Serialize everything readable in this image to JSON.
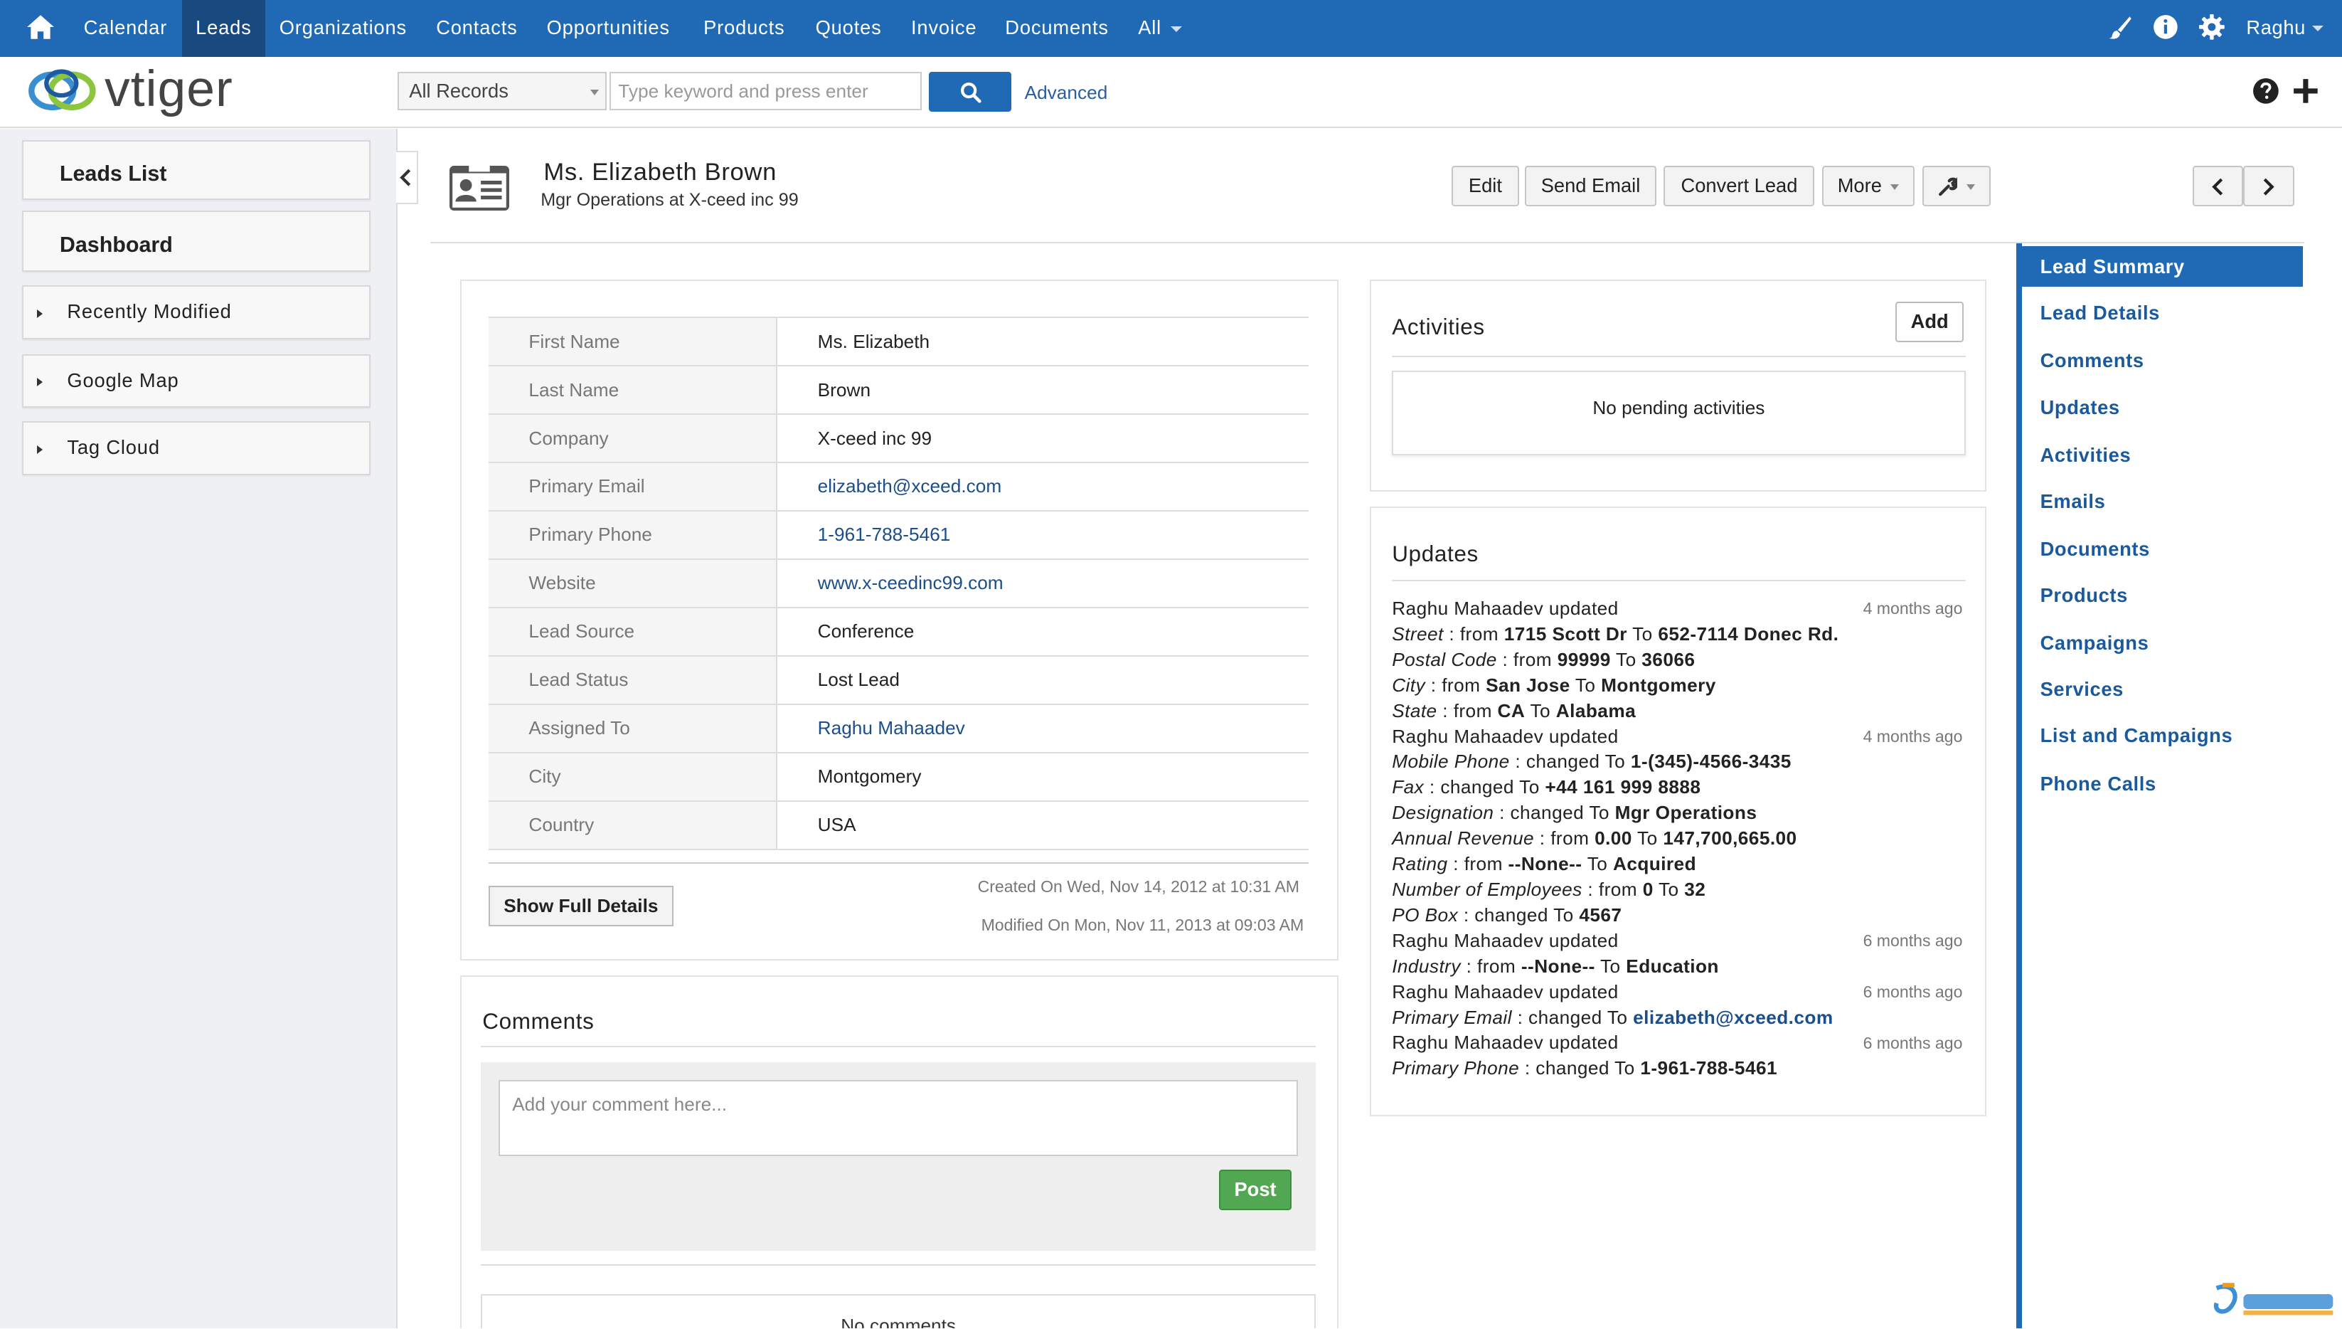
{
  "nav": {
    "menu": [
      "Calendar",
      "Leads",
      "Organizations",
      "Contacts",
      "Opportunities",
      "Products",
      "Quotes",
      "Invoice",
      "Documents",
      "All"
    ],
    "active": "Leads",
    "user": "Raghu"
  },
  "header": {
    "logo_text": "vtiger",
    "records_select": "All Records",
    "search_placeholder": "Type keyword and press enter",
    "advanced": "Advanced"
  },
  "sidebar": {
    "leads_list": "Leads List",
    "dashboard": "Dashboard",
    "widgets": [
      "Recently Modified",
      "Google Map",
      "Tag Cloud"
    ]
  },
  "record": {
    "title": "Ms. Elizabeth Brown",
    "subtitle": "Mgr Operations at X-ceed inc 99",
    "actions": [
      "Edit",
      "Send Email",
      "Convert Lead",
      "More"
    ]
  },
  "details": [
    {
      "label": "First Name",
      "value": "Ms. Elizabeth"
    },
    {
      "label": "Last Name",
      "value": "Brown"
    },
    {
      "label": "Company",
      "value": "X-ceed inc 99"
    },
    {
      "label": "Primary Email",
      "value": "elizabeth@xceed.com"
    },
    {
      "label": "Primary Phone",
      "value": "1-961-788-5461"
    },
    {
      "label": "Website",
      "value": "www.x-ceedinc99.com"
    },
    {
      "label": "Lead Source",
      "value": "Conference"
    },
    {
      "label": "Lead Status",
      "value": "Lost Lead"
    },
    {
      "label": "Assigned To",
      "value": "Raghu Mahaadev"
    },
    {
      "label": "City",
      "value": "Montgomery"
    },
    {
      "label": "Country",
      "value": "USA"
    }
  ],
  "summary": {
    "show_full": "Show Full Details",
    "created": "Created On Wed, Nov 14, 2012 at 10:31 AM",
    "modified": "Modified On Mon, Nov 11, 2013 at 09:03 AM"
  },
  "comments": {
    "title": "Comments",
    "placeholder": "Add your comment here...",
    "post": "Post",
    "empty": "No comments"
  },
  "activities": {
    "title": "Activities",
    "add": "Add",
    "empty": "No pending activities"
  },
  "updates": {
    "title": "Updates",
    "who": "Raghu Mahaadev",
    "verb": "updated",
    "groups": [
      {
        "time": "4 months ago",
        "changes": [
          {
            "field": "Street",
            "kind": "from",
            "from": "1715 Scott Dr",
            "to": "652-7114 Donec Rd."
          },
          {
            "field": "Postal Code",
            "kind": "from",
            "from": "99999",
            "to": "36066"
          },
          {
            "field": "City",
            "kind": "from",
            "from": "San Jose",
            "to": "Montgomery"
          },
          {
            "field": "State",
            "kind": "from",
            "from": "CA",
            "to": "Alabama"
          }
        ]
      },
      {
        "time": "4 months ago",
        "changes": [
          {
            "field": "Mobile Phone",
            "kind": "changed",
            "to": "1-(345)-4566-3435"
          },
          {
            "field": "Fax",
            "kind": "changed",
            "to": "+44 161 999 8888"
          },
          {
            "field": "Designation",
            "kind": "changed",
            "to": "Mgr Operations"
          },
          {
            "field": "Annual Revenue",
            "kind": "from",
            "from": "0.00",
            "to": "147,700,665.00"
          },
          {
            "field": "Rating",
            "kind": "from",
            "from": "--None--",
            "to": "Acquired"
          },
          {
            "field": "Number of Employees",
            "kind": "from",
            "from": "0",
            "to": "32"
          },
          {
            "field": "PO Box",
            "kind": "changed",
            "to": "4567"
          }
        ]
      },
      {
        "time": "6 months ago",
        "changes": [
          {
            "field": "Industry",
            "kind": "from",
            "from": "--None--",
            "to": "Education"
          }
        ]
      },
      {
        "time": "6 months ago",
        "changes": [
          {
            "field": "Primary Email",
            "kind": "changed",
            "to": "elizabeth@xceed.com",
            "link": true
          }
        ]
      },
      {
        "time": "6 months ago",
        "changes": [
          {
            "field": "Primary Phone",
            "kind": "changed",
            "to": "1-961-788-5461"
          }
        ]
      }
    ]
  },
  "related": [
    "Lead Summary",
    "Lead Details",
    "Comments",
    "Updates",
    "Activities",
    "Emails",
    "Documents",
    "Products",
    "Campaigns",
    "Services",
    "List and Campaigns",
    "Phone Calls"
  ],
  "colors": {
    "primary": "#2069b4",
    "post": "#52a852",
    "link": "#1a4f8c"
  }
}
